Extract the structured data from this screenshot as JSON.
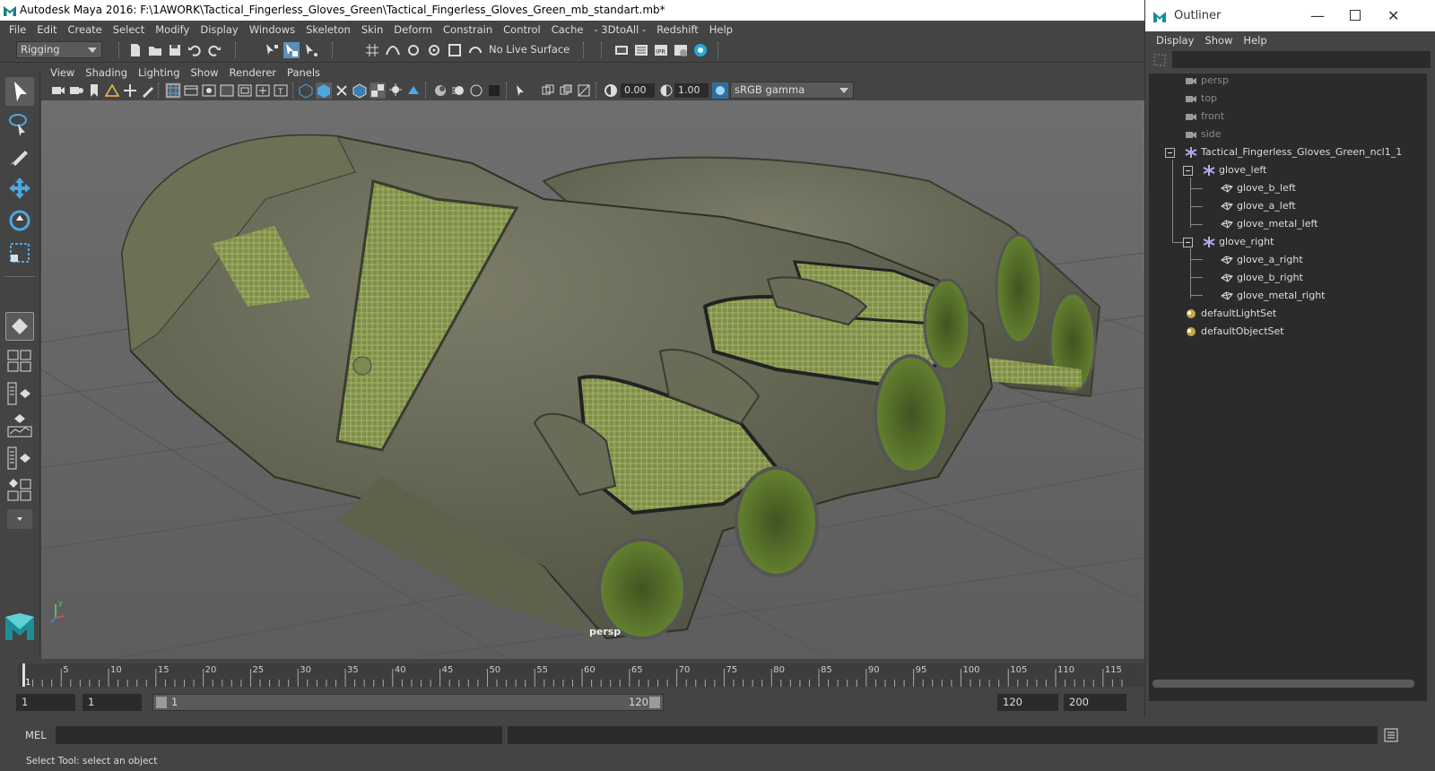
{
  "window": {
    "title": "Autodesk Maya 2016: F:\\1AWORK\\Tactical_Fingerless_Gloves_Green\\Tactical_Fingerless_Gloves_Green_mb_standart.mb*"
  },
  "menubar": [
    "File",
    "Edit",
    "Create",
    "Select",
    "Modify",
    "Display",
    "Windows",
    "Skeleton",
    "Skin",
    "Deform",
    "Constrain",
    "Control",
    "Cache",
    "- 3DtoAll -",
    "Redshift",
    "Help"
  ],
  "shelf": {
    "menuset": "Rigging",
    "live_surface": "No Live Surface"
  },
  "viewport_menu": [
    "View",
    "Shading",
    "Lighting",
    "Show",
    "Renderer",
    "Panels"
  ],
  "viewport_toolbar": {
    "exposure": "0.00",
    "gamma": "1.00",
    "color_space": "sRGB gamma"
  },
  "viewport": {
    "camera_label": "persp"
  },
  "timeline": {
    "ticks": [
      "1",
      "5",
      "10",
      "15",
      "20",
      "25",
      "30",
      "35",
      "40",
      "45",
      "50",
      "55",
      "60",
      "65",
      "70",
      "75",
      "80",
      "85",
      "90",
      "95",
      "100",
      "105",
      "110",
      "115"
    ]
  },
  "range": {
    "start": "1",
    "current": "1",
    "range_start": "1",
    "range_end": "120",
    "end": "120",
    "max": "200"
  },
  "command_line": {
    "label": "MEL"
  },
  "status": {
    "help": "Select Tool: select an object"
  },
  "outliner": {
    "title": "Outliner",
    "menu": [
      "Display",
      "Show",
      "Help"
    ],
    "items": [
      {
        "label": "persp",
        "icon": "camera-icon"
      },
      {
        "label": "top",
        "icon": "camera-icon"
      },
      {
        "label": "front",
        "icon": "camera-icon"
      },
      {
        "label": "side",
        "icon": "camera-icon"
      },
      {
        "label": "Tactical_Fingerless_Gloves_Green_ncl1_1",
        "icon": "group-icon"
      },
      {
        "label": "glove_left",
        "icon": "group-icon"
      },
      {
        "label": "glove_b_left",
        "icon": "mesh-icon"
      },
      {
        "label": "glove_a_left",
        "icon": "mesh-icon"
      },
      {
        "label": "glove_metal_left",
        "icon": "mesh-icon"
      },
      {
        "label": "glove_right",
        "icon": "group-icon"
      },
      {
        "label": "glove_a_right",
        "icon": "mesh-icon"
      },
      {
        "label": "glove_b_right",
        "icon": "mesh-icon"
      },
      {
        "label": "glove_metal_right",
        "icon": "mesh-icon"
      },
      {
        "label": "defaultLightSet",
        "icon": "set-icon"
      },
      {
        "label": "defaultObjectSet",
        "icon": "set-icon"
      }
    ]
  },
  "colors": {
    "maya_teal": "#1b7f85",
    "panel": "#444444",
    "field": "#2b2b2b",
    "glove_leather": "#6a6c58",
    "glove_mesh": "#8b9a5a"
  }
}
